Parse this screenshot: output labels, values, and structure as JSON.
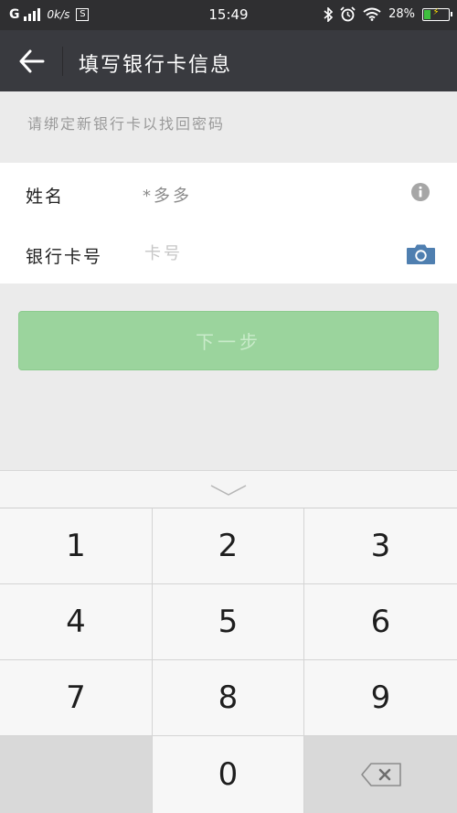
{
  "status_bar": {
    "network": "G",
    "speed": "0k/s",
    "sim_badge": "S",
    "time": "15:49",
    "battery_text": "28%",
    "battery_level": 0.28
  },
  "header": {
    "title": "填写银行卡信息"
  },
  "hint": "请绑定新银行卡以找回密码",
  "form": {
    "name_label": "姓名",
    "name_value": "*多多",
    "card_label": "银行卡号",
    "card_placeholder": "卡号",
    "card_value": ""
  },
  "next_button": "下一步",
  "keypad": {
    "keys": [
      "1",
      "2",
      "3",
      "4",
      "5",
      "6",
      "7",
      "8",
      "9",
      "0"
    ]
  },
  "colors": {
    "header_bg": "#393a3f",
    "button_bg": "#9bd49d",
    "camera_icon": "#4f7fb0"
  }
}
